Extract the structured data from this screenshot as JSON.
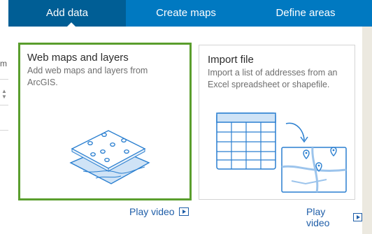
{
  "tabs": [
    {
      "label": "Add data"
    },
    {
      "label": "Create maps"
    },
    {
      "label": "Define areas"
    }
  ],
  "background": {
    "left_fragment": "m"
  },
  "cards": [
    {
      "title": "Web maps and layers",
      "description": "Add web maps and layers from ArcGIS.",
      "illustration": "map-layers-icon"
    },
    {
      "title": "Import file",
      "description": "Import a list of addresses from an Excel spreadsheet or shapefile.",
      "illustration": "spreadsheet-to-map-icon"
    }
  ],
  "play_video_label": "Play video",
  "colors": {
    "header": "#0079c1",
    "active_tab": "#005e95",
    "selected_border": "#5a9e2d",
    "link": "#1f5ea8",
    "illustration": "#2a7fd0"
  }
}
